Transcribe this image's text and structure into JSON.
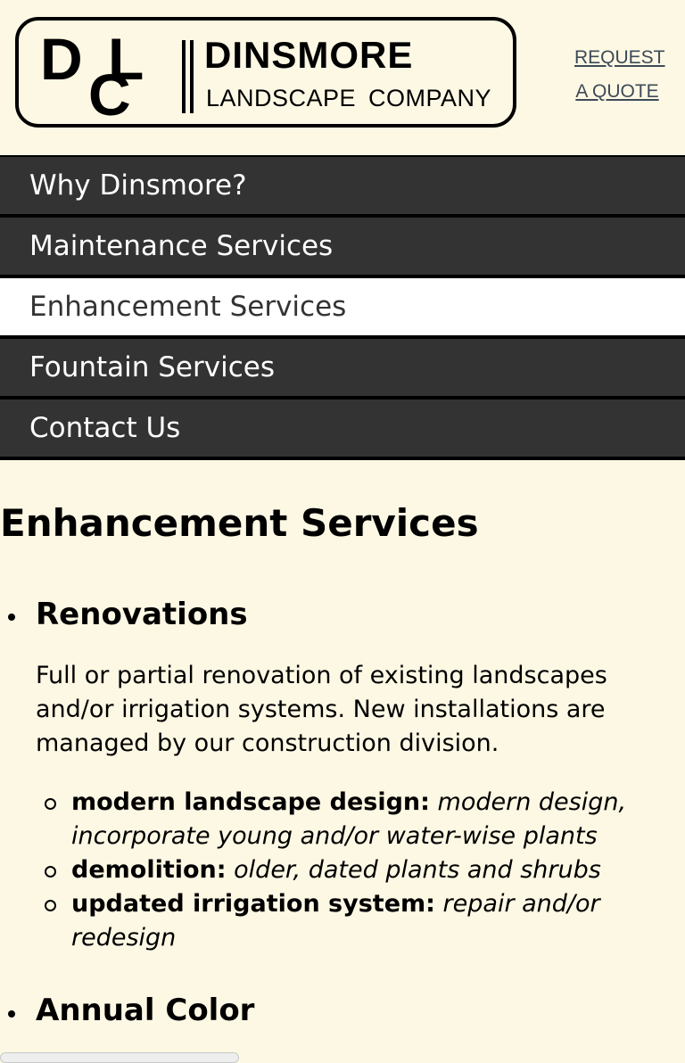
{
  "header": {
    "logo": {
      "monogram_letters": [
        "D",
        "L",
        "C"
      ],
      "brand_name": "DINSMORE",
      "tagline": "LANDSCAPE COMPANY"
    },
    "request_quote": {
      "line1": "REQUEST",
      "line2": "A QUOTE"
    }
  },
  "nav": {
    "items": [
      {
        "label": "Why Dinsmore?",
        "active": false
      },
      {
        "label": "Maintenance Services",
        "active": false
      },
      {
        "label": "Enhancement Services",
        "active": true
      },
      {
        "label": "Fountain Services",
        "active": false
      },
      {
        "label": "Contact Us",
        "active": false
      }
    ]
  },
  "main": {
    "page_title": "Enhancement Services",
    "sections": [
      {
        "heading": "Renovations",
        "description": "Full or partial renovation of existing landscapes and/or irrigation systems. New installations are managed by our construction division.",
        "items": [
          {
            "term": "modern landscape design:",
            "detail": "modern design, incorporate young and/or water-wise plants"
          },
          {
            "term": "demolition:",
            "detail": "older, dated plants and shrubs"
          },
          {
            "term": "updated irrigation system:",
            "detail": "repair and/or redesign"
          }
        ]
      },
      {
        "heading": "Annual Color"
      }
    ]
  },
  "colors": {
    "page_background": "#fdf8e4",
    "nav_background": "#333333",
    "nav_active_background": "#ffffff",
    "nav_text": "#ffffff",
    "link_color": "#3d4a57"
  }
}
